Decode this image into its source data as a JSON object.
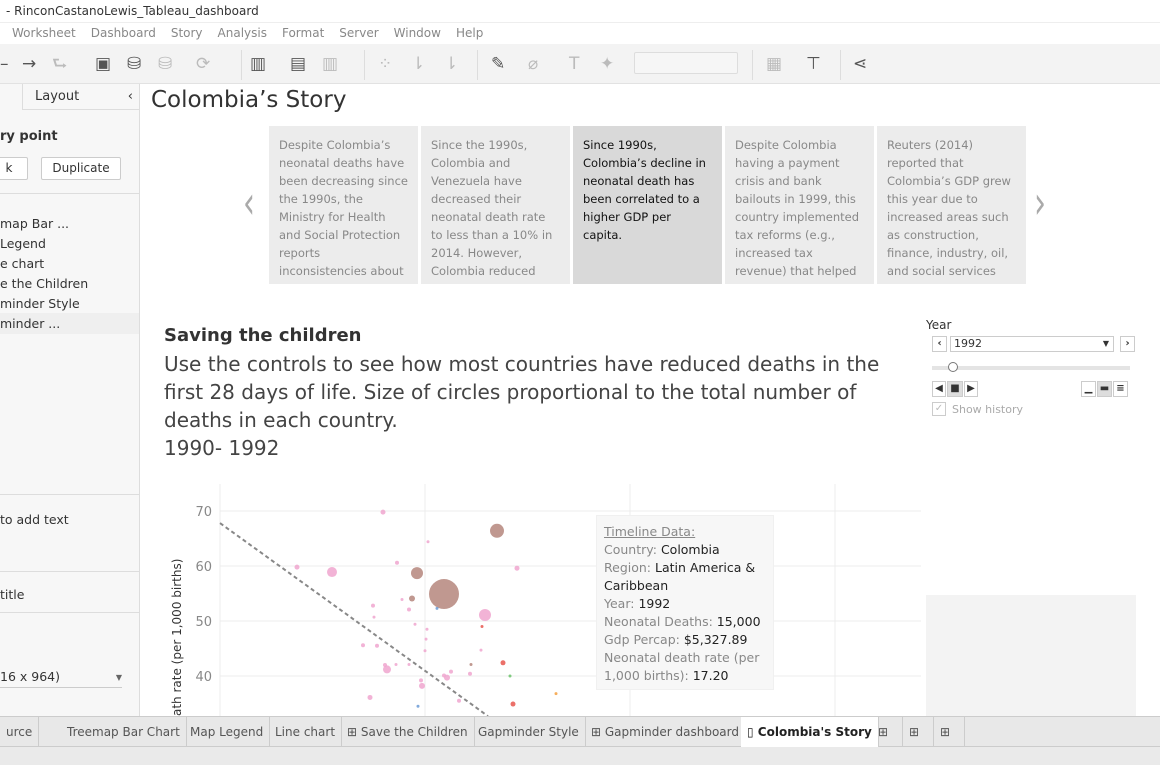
{
  "window": {
    "title": "- RinconCastanoLewis_Tableau_dashboard"
  },
  "menu": [
    "Worksheet",
    "Dashboard",
    "Story",
    "Analysis",
    "Format",
    "Server",
    "Window",
    "Help"
  ],
  "left_panel": {
    "tab_layout": "Layout",
    "section_title": "ry point",
    "blank_button": "k",
    "duplicate_button": "Duplicate",
    "story_items": [
      "map Bar ...",
      "Legend",
      "e chart",
      "e the Children",
      "minder Style",
      "minder ..."
    ],
    "add_text": "to add text",
    "title_option": "title",
    "size_select": "16 x 964)"
  },
  "story": {
    "title": "Colombia’s Story",
    "points": [
      "Despite Colombia’s neonatal deaths have been decreasing since the 1990s, the Ministry for Health and Social Protection reports inconsistencies about",
      "Since the 1990s, Colombia and Venezuela have decreased their neonatal death rate to less than a 10% in 2014. However, Colombia reduced this",
      "Since 1990s, Colombia’s decline in neonatal death has been correlated to a higher GDP per capita.",
      "Despite Colombia having a payment crisis and bank bailouts in 1999, this country implemented tax reforms (e.g., increased tax revenue) that helped",
      "Reuters (2014) reported that Colombia’s GDP grew this year due to increased areas such as construction, finance, industry, oil, and social services"
    ],
    "active_index": 2
  },
  "dashboard": {
    "title": "Saving the children",
    "subtitle": "Use the controls to see how most countries have reduced deaths in the first 28 days of life. Size of circles proportional to the total number of deaths in each country.",
    "range": "1990- 1992"
  },
  "year_control": {
    "label": "Year",
    "value": "1992",
    "show_history": "Show history",
    "show_history_checked": true
  },
  "tooltip": {
    "heading": "Timeline Data:",
    "country_label": "Country: ",
    "country": "Colombia",
    "region_label": "Region: ",
    "region": "Latin America & Caribbean",
    "year_label": "Year: ",
    "year": "1992",
    "deaths_label": "Neonatal Deaths: ",
    "deaths": "15,000",
    "gdp_label": "Gdp Percap: ",
    "gdp": "$5,327.89",
    "rate_label": "Neonatal death rate (per 1,000 births): ",
    "rate": "17.20"
  },
  "chart_data": {
    "type": "scatter",
    "ylabel": "ath rate (per 1,000 births)",
    "yticks": [
      "70",
      "60",
      "50",
      "40"
    ],
    "ylim": [
      30,
      75
    ],
    "grid": true,
    "trendline": {
      "style": "dashed",
      "y_start": 67.8,
      "y_end": 32.7
    },
    "colors": {
      "pink": "#f0a6cf",
      "brown": "#b5867c",
      "red": "#e8574f",
      "green": "#6cc36c",
      "orange": "#f5a040",
      "blue": "#6b9bd6"
    },
    "points": [
      {
        "y": 69.8,
        "c": "pink"
      },
      {
        "y": 59.8,
        "c": "pink"
      },
      {
        "y": 58.9,
        "c": "pink"
      },
      {
        "y": 60.6,
        "c": "pink"
      },
      {
        "y": 64.4,
        "c": "pink"
      },
      {
        "y": 58.7,
        "c": "brown"
      },
      {
        "y": 54.9,
        "c": "brown"
      },
      {
        "y": 54.1,
        "c": "brown"
      },
      {
        "y": 66.4,
        "c": "brown"
      },
      {
        "y": 59.6,
        "c": "pink"
      },
      {
        "y": 51.1,
        "c": "pink"
      },
      {
        "y": 52.8,
        "c": "pink"
      },
      {
        "y": 50.7,
        "c": "pink"
      },
      {
        "y": 52.1,
        "c": "pink"
      },
      {
        "y": 53.9,
        "c": "pink"
      },
      {
        "y": 49.4,
        "c": "pink"
      },
      {
        "y": 48.5,
        "c": "pink"
      },
      {
        "y": 49.0,
        "c": "red"
      },
      {
        "y": 45.6,
        "c": "pink"
      },
      {
        "y": 45.5,
        "c": "pink"
      },
      {
        "y": 46.7,
        "c": "pink"
      },
      {
        "y": 44.6,
        "c": "pink"
      },
      {
        "y": 44.7,
        "c": "pink"
      },
      {
        "y": 42.0,
        "c": "pink"
      },
      {
        "y": 41.2,
        "c": "pink"
      },
      {
        "y": 42.1,
        "c": "pink"
      },
      {
        "y": 42.1,
        "c": "pink"
      },
      {
        "y": 42.1,
        "c": "brown"
      },
      {
        "y": 42.4,
        "c": "red"
      },
      {
        "y": 40.0,
        "c": "green"
      },
      {
        "y": 40.1,
        "c": "pink"
      },
      {
        "y": 39.7,
        "c": "pink"
      },
      {
        "y": 40.8,
        "c": "pink"
      },
      {
        "y": 40.4,
        "c": "pink"
      },
      {
        "y": 39.2,
        "c": "pink"
      },
      {
        "y": 38.2,
        "c": "pink"
      },
      {
        "y": 36.1,
        "c": "pink"
      },
      {
        "y": 35.5,
        "c": "pink"
      },
      {
        "y": 34.9,
        "c": "red"
      },
      {
        "y": 36.8,
        "c": "orange"
      },
      {
        "y": 34.5,
        "c": "blue"
      },
      {
        "y": 52.3,
        "c": "blue"
      }
    ]
  },
  "tabs": [
    "urce",
    "Treemap Bar Chart",
    "Map Legend",
    "Line chart",
    "Save the Children",
    "Gapminder Style",
    "Gapminder dashboard",
    "Colombia's Story"
  ],
  "tab_icons": {
    "Save the Children": "dashboard-icon",
    "Gapminder dashboard": "dashboard-icon",
    "Colombia's Story": "story-icon"
  },
  "active_tab": "Colombia's Story"
}
